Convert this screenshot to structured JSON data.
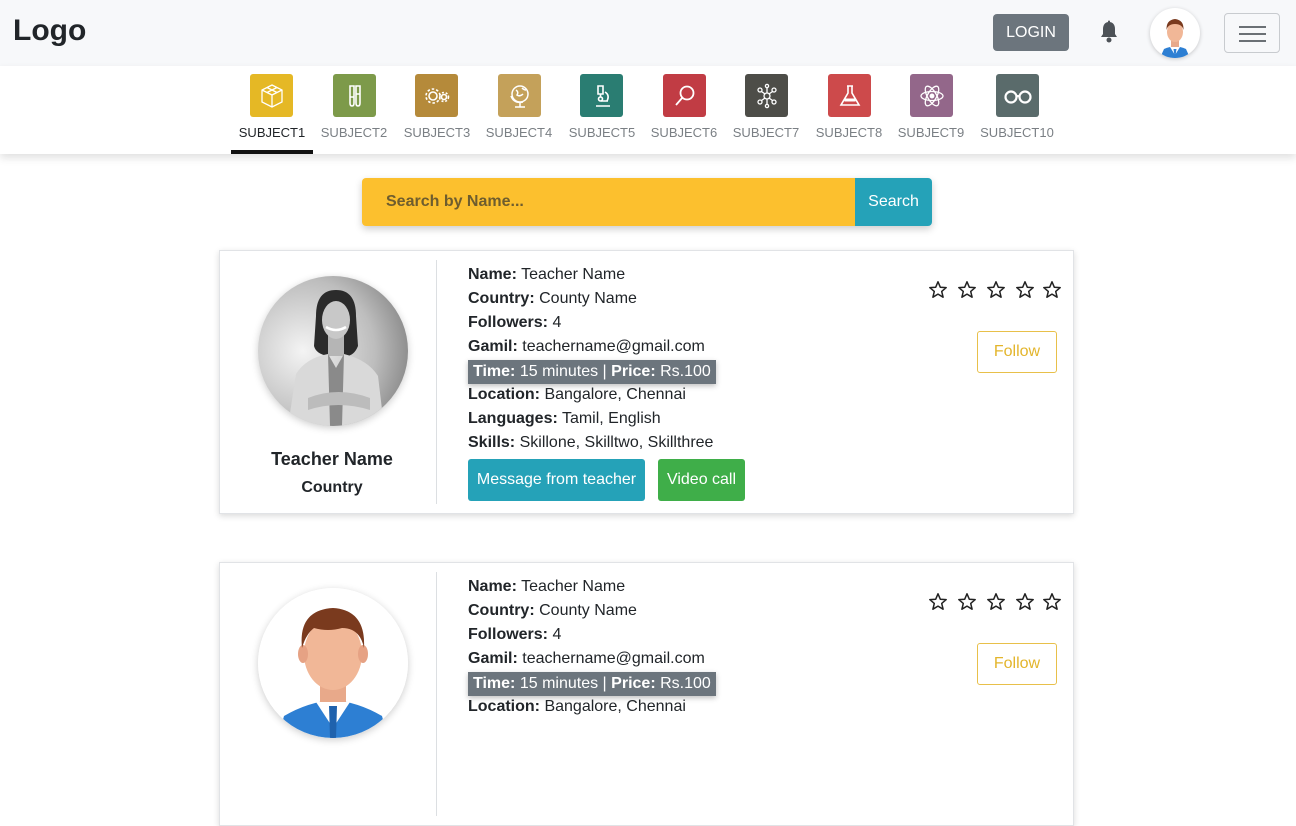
{
  "header": {
    "logo": "Logo",
    "login_label": "LOGIN",
    "bell_icon": "bell-icon",
    "menu_icon": "hamburger-icon"
  },
  "subjects": [
    {
      "label": "SUBJECT1",
      "color": "#e5b825",
      "icon": "cube-icon",
      "active": true
    },
    {
      "label": "SUBJECT2",
      "color": "#7d9a4a",
      "icon": "test-tubes-icon"
    },
    {
      "label": "SUBJECT3",
      "color": "#b58a3a",
      "icon": "gears-icon"
    },
    {
      "label": "SUBJECT4",
      "color": "#c4a15a",
      "icon": "globe-icon"
    },
    {
      "label": "SUBJECT5",
      "color": "#2a7d72",
      "icon": "microscope-icon"
    },
    {
      "label": "SUBJECT6",
      "color": "#c13c44",
      "icon": "magnifier-icon"
    },
    {
      "label": "SUBJECT7",
      "color": "#4d4d48",
      "icon": "molecule-icon"
    },
    {
      "label": "SUBJECT8",
      "color": "#cd4a4b",
      "icon": "flask-icon"
    },
    {
      "label": "SUBJECT9",
      "color": "#93678a",
      "icon": "atom-icon"
    },
    {
      "label": "SUBJECT10",
      "color": "#5a6b6b",
      "icon": "glasses-icon"
    }
  ],
  "search": {
    "placeholder": "Search by Name...",
    "button_label": "Search"
  },
  "cards": [
    {
      "name": "Teacher Name",
      "country": "Country",
      "fields": {
        "name_label": "Name:",
        "name_value": "Teacher Name",
        "country_label": "Country:",
        "country_value": "County Name",
        "followers_label": "Followers:",
        "followers_value": "4",
        "email_label": "Gamil:",
        "email_value": "teachername@gmail.com",
        "time_label": "Time:",
        "time_value": "15 minutes |",
        "price_label": "Price:",
        "price_value": "Rs.100",
        "location_label": "Location:",
        "location_value": "Bangalore, Chennai",
        "languages_label": "Languages:",
        "languages_value": "Tamil, English",
        "skills_label": "Skills:",
        "skills_value": "Skillone, Skilltwo, Skillthree"
      },
      "message_label": "Message from teacher",
      "video_label": "Video call",
      "follow_label": "Follow",
      "rating": 0
    },
    {
      "fields": {
        "name_label": "Name:",
        "name_value": "Teacher Name",
        "country_label": "Country:",
        "country_value": "County Name",
        "followers_label": "Followers:",
        "followers_value": "4",
        "email_label": "Gamil:",
        "email_value": "teachername@gmail.com",
        "time_label": "Time:",
        "time_value": "15 minutes |",
        "price_label": "Price:",
        "price_value": "Rs.100",
        "location_label": "Location:",
        "location_value": "Bangalore, Chennai"
      },
      "follow_label": "Follow",
      "rating": 0
    }
  ]
}
